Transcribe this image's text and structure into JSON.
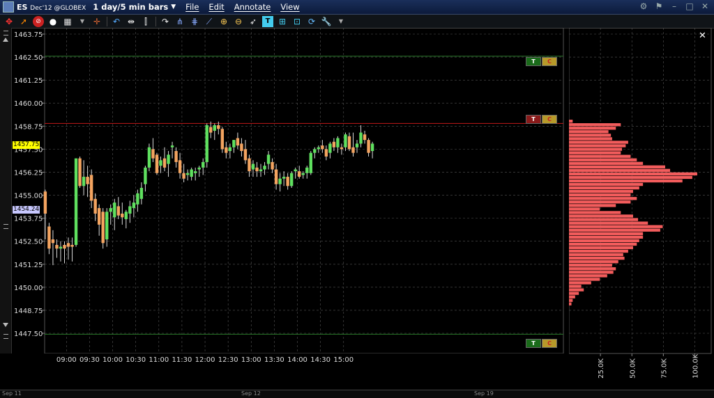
{
  "titlebar": {
    "symbol": "ES",
    "contract": "Dec'12 @GLOBEX",
    "bar_setting": "1 day/5 min bars",
    "menus": [
      "File",
      "Edit",
      "Annotate",
      "View"
    ]
  },
  "toolbar": {
    "icons": [
      "crosshair-icon",
      "arrow-icon",
      "no-entry-icon",
      "circle-icon",
      "layout-icon",
      "dropdown-icon",
      "cursor-icon",
      "undo-icon",
      "mirror-icon",
      "bars-icon",
      "redo-icon",
      "fork-icon",
      "pitchfork-icon",
      "fan-icon",
      "zoom-in-icon",
      "zoom-out-icon",
      "pointer-icon",
      "text-icon",
      "date-icon",
      "time-icon",
      "refresh-icon",
      "wrench-icon",
      "more-icon"
    ]
  },
  "colors": {
    "background": "#000000",
    "grid": "#555555",
    "up_candle": "#5fe05f",
    "down_candle": "#f4a460",
    "volume_bar": "#f25c5c",
    "current_price_bg": "#ffff00",
    "last_price_bg": "#c8c8ff",
    "resistance_line": "#c21a1a",
    "support_line": "#2a7a2a"
  },
  "price_axis": {
    "labels": [
      "1463.75",
      "1462.50",
      "1461.25",
      "1460.00",
      "1458.75",
      "1457.50",
      "1456.25",
      "1455.00",
      "1453.75",
      "1452.50",
      "1451.25",
      "1450.00",
      "1448.75",
      "1447.50"
    ],
    "current_price": "1457.75",
    "last_price": "1454.24"
  },
  "time_axis": {
    "labels": [
      "09:00",
      "09:30",
      "10:00",
      "10:30",
      "11:00",
      "11:30",
      "12:00",
      "12:30",
      "13:00",
      "13:30",
      "14:00",
      "14:30",
      "15:00"
    ]
  },
  "lines": [
    {
      "price": 1462.55,
      "color": "support_line",
      "badges": [
        "T",
        "C"
      ]
    },
    {
      "price": 1458.9,
      "color": "resistance_line",
      "badges": [
        "T",
        "C"
      ]
    },
    {
      "price": 1447.45,
      "color": "support_line",
      "badges": [
        "T",
        "C"
      ]
    }
  ],
  "chart_data": {
    "type": "candlestick",
    "x_unit": "5 min bars from 08:30",
    "ylim": [
      1446.5,
      1464.5
    ],
    "bars": [
      [
        1455.2,
        1455.3,
        1452.6,
        1454.0
      ],
      [
        1453.3,
        1453.5,
        1451.8,
        1452.1
      ],
      [
        1452.6,
        1453.1,
        1451.2,
        1452.4
      ],
      [
        1452.3,
        1452.6,
        1451.6,
        1452.1
      ],
      [
        1452.1,
        1452.5,
        1451.4,
        1452.2
      ],
      [
        1452.3,
        1452.5,
        1451.3,
        1452.1
      ],
      [
        1452.4,
        1452.7,
        1451.5,
        1452.2
      ],
      [
        1452.3,
        1452.7,
        1451.4,
        1452.2
      ],
      [
        1452.3,
        1457.0,
        1452.2,
        1457.0
      ],
      [
        1457.0,
        1457.1,
        1455.4,
        1455.5
      ],
      [
        1455.5,
        1456.9,
        1455.0,
        1456.0
      ],
      [
        1456.0,
        1456.6,
        1454.9,
        1455.6
      ],
      [
        1456.1,
        1456.4,
        1454.3,
        1454.7
      ],
      [
        1454.8,
        1455.1,
        1453.6,
        1454.0
      ],
      [
        1454.3,
        1454.5,
        1452.8,
        1453.4
      ],
      [
        1454.1,
        1454.3,
        1452.1,
        1452.4
      ],
      [
        1452.6,
        1454.3,
        1452.2,
        1454.1
      ],
      [
        1454.1,
        1454.5,
        1453.4,
        1454.3
      ],
      [
        1453.8,
        1454.8,
        1453.1,
        1454.6
      ],
      [
        1454.4,
        1454.9,
        1453.7,
        1453.9
      ],
      [
        1454.0,
        1454.6,
        1453.4,
        1453.8
      ],
      [
        1453.7,
        1454.2,
        1453.2,
        1454.1
      ],
      [
        1454.0,
        1454.7,
        1453.5,
        1454.4
      ],
      [
        1454.3,
        1455.0,
        1453.8,
        1454.6
      ],
      [
        1454.5,
        1455.3,
        1454.1,
        1455.1
      ],
      [
        1454.8,
        1455.7,
        1454.5,
        1455.4
      ],
      [
        1455.6,
        1456.6,
        1455.2,
        1456.5
      ],
      [
        1456.5,
        1457.8,
        1456.3,
        1457.6
      ],
      [
        1457.5,
        1458.1,
        1456.8,
        1457.0
      ],
      [
        1457.2,
        1457.3,
        1456.1,
        1456.2
      ],
      [
        1456.6,
        1457.1,
        1456.2,
        1456.9
      ],
      [
        1457.0,
        1457.6,
        1456.3,
        1456.5
      ],
      [
        1456.7,
        1457.4,
        1456.0,
        1457.2
      ],
      [
        1457.6,
        1457.9,
        1457.0,
        1457.7
      ],
      [
        1457.4,
        1457.6,
        1456.5,
        1456.8
      ],
      [
        1456.9,
        1457.3,
        1455.9,
        1456.2
      ],
      [
        1456.2,
        1456.7,
        1455.7,
        1455.9
      ],
      [
        1456.1,
        1456.4,
        1455.8,
        1456.2
      ],
      [
        1456.0,
        1456.5,
        1455.8,
        1456.4
      ],
      [
        1456.2,
        1456.5,
        1455.8,
        1456.3
      ],
      [
        1456.4,
        1456.6,
        1456.0,
        1456.5
      ],
      [
        1456.5,
        1457.0,
        1456.1,
        1456.8
      ],
      [
        1456.8,
        1458.9,
        1456.5,
        1458.8
      ],
      [
        1458.7,
        1459.0,
        1458.1,
        1458.4
      ],
      [
        1458.5,
        1458.9,
        1458.0,
        1458.8
      ],
      [
        1458.8,
        1459.0,
        1458.3,
        1458.6
      ],
      [
        1458.6,
        1458.7,
        1457.3,
        1457.5
      ],
      [
        1457.6,
        1457.9,
        1457.0,
        1457.3
      ],
      [
        1457.4,
        1457.8,
        1457.0,
        1457.6
      ],
      [
        1457.6,
        1458.0,
        1457.3,
        1458.0
      ],
      [
        1458.1,
        1458.4,
        1457.5,
        1457.7
      ],
      [
        1457.8,
        1458.1,
        1457.1,
        1457.4
      ],
      [
        1457.5,
        1458.0,
        1456.7,
        1456.9
      ],
      [
        1457.0,
        1457.2,
        1456.0,
        1456.3
      ],
      [
        1456.4,
        1456.9,
        1456.0,
        1456.7
      ],
      [
        1456.5,
        1456.8,
        1456.0,
        1456.3
      ],
      [
        1456.3,
        1456.7,
        1456.0,
        1456.4
      ],
      [
        1456.4,
        1456.8,
        1456.1,
        1456.6
      ],
      [
        1456.7,
        1457.4,
        1456.4,
        1457.2
      ],
      [
        1456.8,
        1457.0,
        1456.2,
        1456.4
      ],
      [
        1456.4,
        1456.7,
        1455.3,
        1455.6
      ],
      [
        1455.6,
        1456.2,
        1455.2,
        1455.9
      ],
      [
        1455.9,
        1456.3,
        1455.5,
        1456.0
      ],
      [
        1456.0,
        1456.2,
        1455.3,
        1455.5
      ],
      [
        1455.5,
        1456.3,
        1455.4,
        1456.2
      ],
      [
        1456.3,
        1456.5,
        1455.9,
        1456.4
      ],
      [
        1456.3,
        1456.6,
        1455.9,
        1456.0
      ],
      [
        1456.1,
        1456.3,
        1455.9,
        1456.2
      ],
      [
        1456.2,
        1456.6,
        1455.9,
        1456.5
      ],
      [
        1456.2,
        1457.4,
        1456.1,
        1457.3
      ],
      [
        1457.3,
        1457.6,
        1457.0,
        1457.5
      ],
      [
        1457.5,
        1457.7,
        1457.3,
        1457.6
      ],
      [
        1457.7,
        1458.0,
        1457.3,
        1457.5
      ],
      [
        1457.5,
        1457.7,
        1456.9,
        1457.1
      ],
      [
        1457.3,
        1457.9,
        1457.0,
        1457.8
      ],
      [
        1457.9,
        1458.1,
        1457.4,
        1457.6
      ],
      [
        1457.6,
        1458.2,
        1457.3,
        1458.1
      ],
      [
        1457.6,
        1457.8,
        1457.2,
        1457.5
      ],
      [
        1457.6,
        1458.4,
        1457.4,
        1458.3
      ],
      [
        1458.2,
        1458.4,
        1457.4,
        1457.5
      ],
      [
        1457.6,
        1458.4,
        1457.1,
        1457.3
      ],
      [
        1457.6,
        1458.0,
        1457.3,
        1457.8
      ],
      [
        1457.8,
        1458.8,
        1457.6,
        1458.4
      ],
      [
        1458.3,
        1458.5,
        1457.8,
        1458.0
      ],
      [
        1458.0,
        1458.1,
        1457.1,
        1457.3
      ],
      [
        1457.4,
        1457.9,
        1457.0,
        1457.8
      ]
    ]
  },
  "volume_profile": {
    "axis_labels": [
      "25.0K",
      "50.0K",
      "75.0K",
      "100.0K"
    ],
    "max": 110,
    "rows": [
      3,
      42,
      38,
      32,
      34,
      35,
      48,
      46,
      43,
      42,
      50,
      55,
      60,
      78,
      82,
      104,
      100,
      92,
      60,
      57,
      52,
      50,
      55,
      50,
      38,
      25,
      42,
      52,
      56,
      64,
      76,
      74,
      60,
      60,
      57,
      55,
      52,
      48,
      44,
      45,
      40,
      35,
      38,
      36,
      31,
      25,
      18,
      10,
      12,
      8,
      5,
      3,
      2
    ]
  },
  "bottom_timebar": {
    "labels": [
      "Sep 11",
      "Sep 12",
      "Sep 19"
    ]
  }
}
